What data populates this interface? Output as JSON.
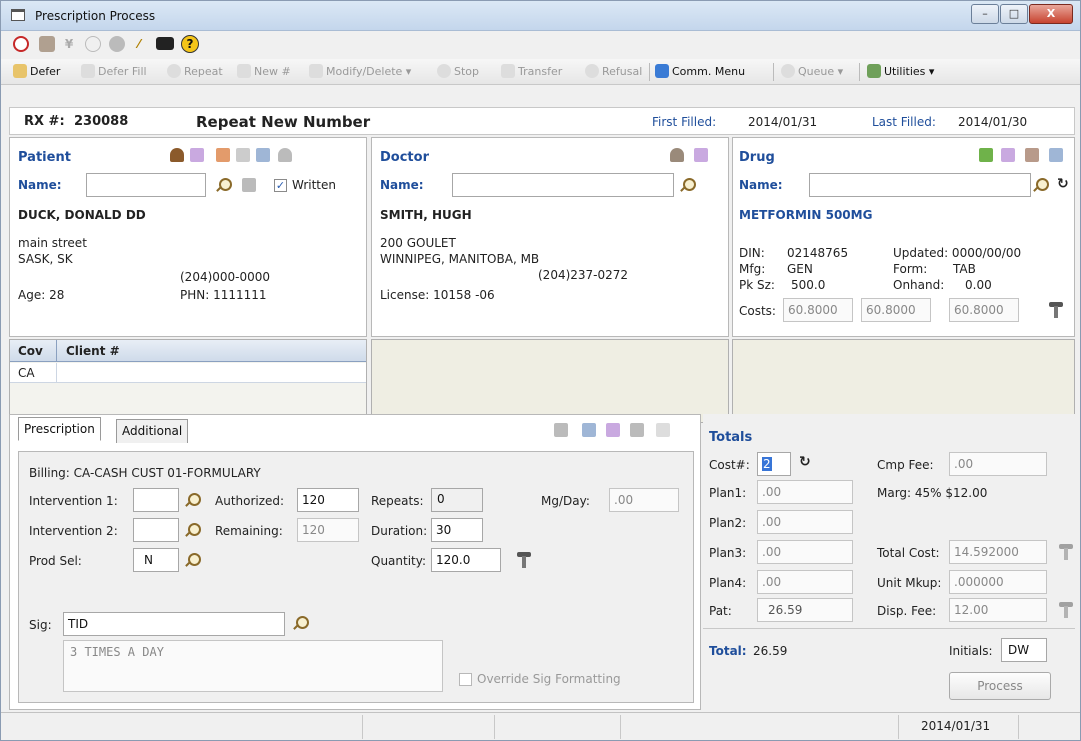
{
  "window": {
    "title": "Prescription Process",
    "minimize_label": "–",
    "maximize_label": "□",
    "close_label": "X"
  },
  "toolbar2": {
    "defer": "Defer",
    "defer_fill": "Defer Fill",
    "repeat": "Repeat",
    "new": "New #",
    "modify_delete": "Modify/Delete ▾",
    "stop": "Stop",
    "transfer": "Transfer",
    "refusal": "Refusal",
    "comm_menu": "Comm. Menu",
    "queue": "Queue ▾",
    "utilities": "Utilities ▾"
  },
  "rx": {
    "rx_label": "RX #:",
    "rx_number": "230088",
    "status": "Repeat New Number",
    "first_filled_label": "First Filled:",
    "first_filled": "2014/01/31",
    "last_filled_label": "Last Filled:",
    "last_filled": "2014/01/30"
  },
  "patient": {
    "header": "Patient",
    "name_label": "Name:",
    "name_value": "",
    "written_label": "Written",
    "written_checked": true,
    "full_name": "DUCK, DONALD DD",
    "address1": "main street",
    "address2": "SASK, SK",
    "phone": "(204)000-0000",
    "age": "Age: 28",
    "phn": "PHN: 1111111"
  },
  "doctor": {
    "header": "Doctor",
    "name_label": "Name:",
    "name_value": "",
    "full_name": "SMITH, HUGH",
    "address1": "200 GOULET",
    "address2": "WINNIPEG, MANITOBA, MB",
    "phone": "(204)237-0272",
    "license": "License: 10158 -06"
  },
  "drug": {
    "header": "Drug",
    "name_label": "Name:",
    "name_value": "",
    "drug_name": "METFORMIN 500MG",
    "din_label": "DIN:",
    "din": "02148765",
    "updated": "Updated: 0000/00/00",
    "mfg_label": "Mfg:",
    "mfg": "GEN",
    "form_label": "Form:",
    "form": "TAB",
    "pksz_label": "Pk Sz:",
    "pksz": "500.0",
    "onhand_label": "Onhand:",
    "onhand": "0.00",
    "costs_label": "Costs:",
    "cost1": "60.8000",
    "cost2": "60.8000",
    "cost3": "60.8000"
  },
  "coverage": {
    "col_cov": "Cov",
    "col_client": "Client #",
    "rows": [
      {
        "cov": "CA",
        "client": ""
      }
    ]
  },
  "prescription": {
    "tab_prescription": "Prescription",
    "tab_additional": "Additional",
    "billing": "Billing: CA-CASH CUST  01-FORMULARY",
    "intervention1_label": "Intervention 1:",
    "intervention1": "",
    "intervention2_label": "Intervention 2:",
    "intervention2": "",
    "prodsel_label": "Prod Sel:",
    "prodsel": "N",
    "authorized_label": "Authorized:",
    "authorized": "120",
    "remaining_label": "Remaining:",
    "remaining": "120",
    "repeats_label": "Repeats:",
    "repeats": "0",
    "duration_label": "Duration:",
    "duration": "30",
    "quantity_label": "Quantity:",
    "quantity": "120.0",
    "mgday_label": "Mg/Day:",
    "mgday": ".00",
    "sig_label": "Sig:",
    "sig": "TID",
    "sig_expanded": "3 TIMES A DAY",
    "override_label": "Override Sig Formatting"
  },
  "totals": {
    "header": "Totals",
    "cost_label": "Cost#:",
    "cost": "2",
    "plan1_label": "Plan1:",
    "plan1": ".00",
    "plan2_label": "Plan2:",
    "plan2": ".00",
    "plan3_label": "Plan3:",
    "plan3": ".00",
    "plan4_label": "Plan4:",
    "plan4": ".00",
    "pat_label": "Pat:",
    "pat": "26.59",
    "cmpfee_label": "Cmp Fee:",
    "cmpfee": ".00",
    "marg": "Marg:  45%  $12.00",
    "totalcost_label": "Total Cost:",
    "totalcost": "14.592000",
    "unitmkup_label": "Unit Mkup:",
    "unitmkup": ".000000",
    "dispfee_label": "Disp. Fee:",
    "dispfee": "12.00",
    "total_label": "Total:",
    "total": "26.59",
    "initials_label": "Initials:",
    "initials": "DW",
    "process_label": "Process"
  },
  "statusbar": {
    "date": "2014/01/31"
  }
}
